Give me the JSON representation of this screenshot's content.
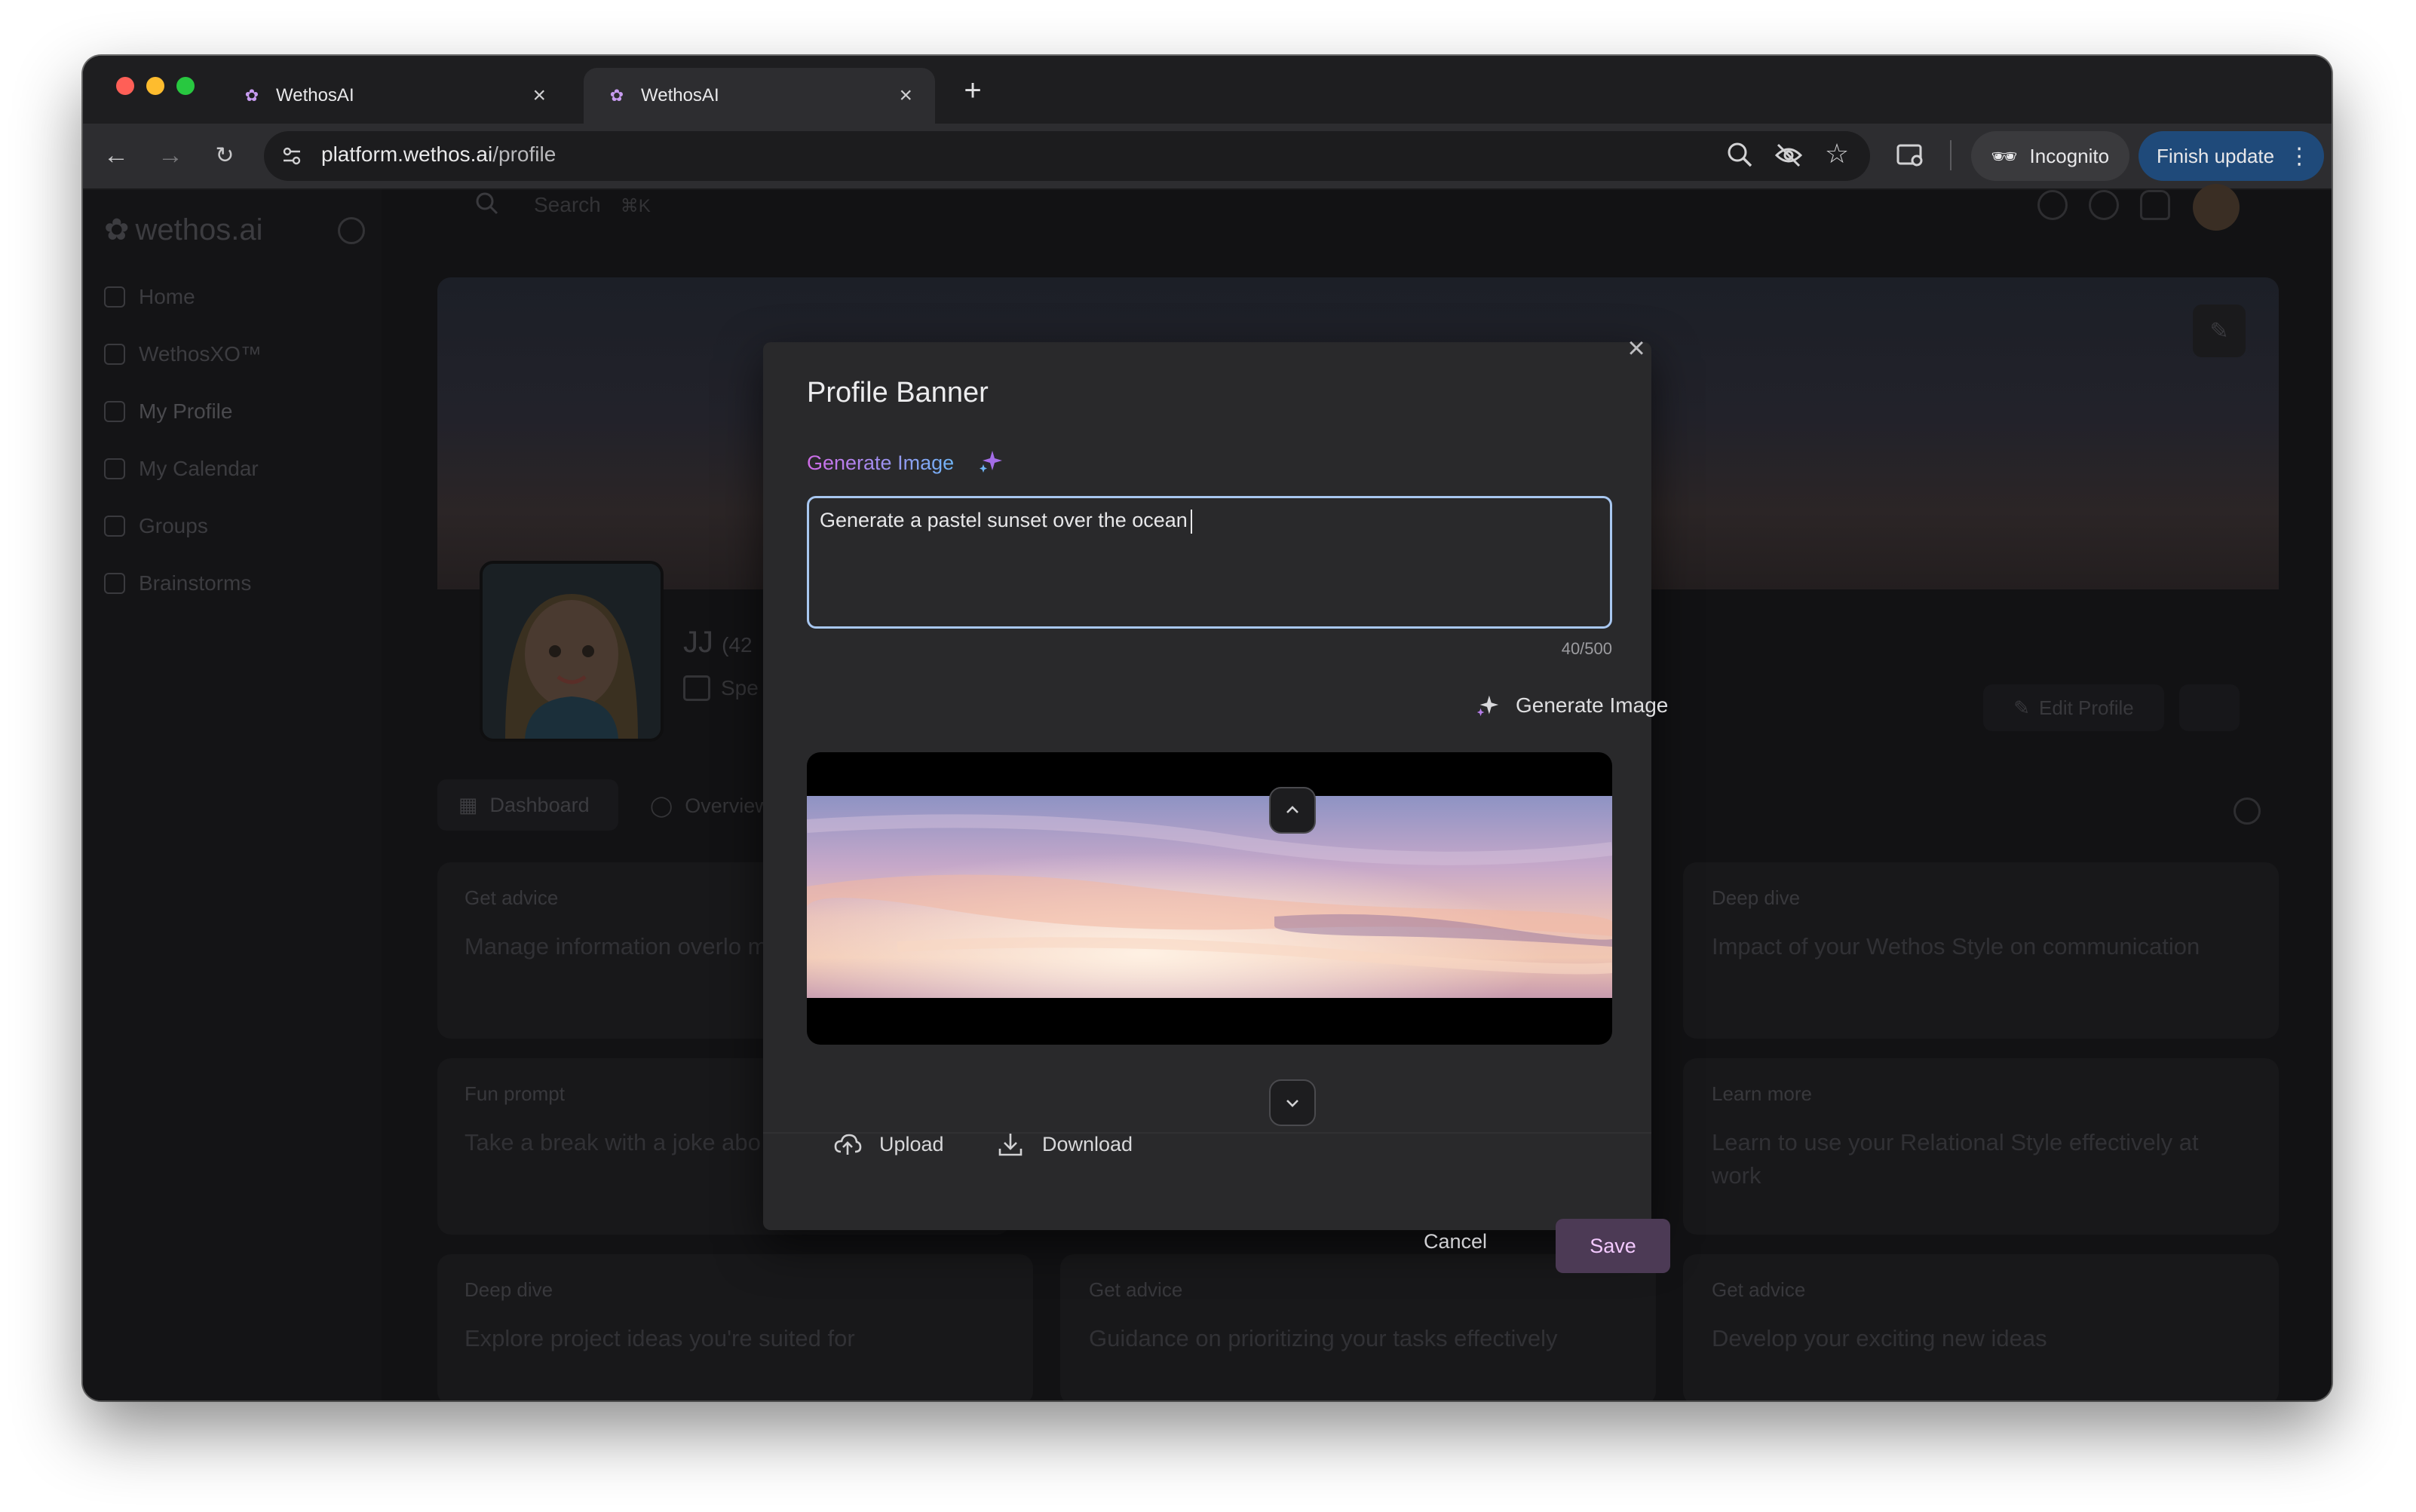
{
  "browser": {
    "tabs": [
      {
        "title": "WethosAI",
        "active": false
      },
      {
        "title": "WethosAI",
        "active": true
      }
    ],
    "new_tab_glyph": "+",
    "url_host": "platform.wethos.ai",
    "url_path": "/profile",
    "incognito_label": "Incognito",
    "update_label": "Finish update"
  },
  "app": {
    "logo_text": "wethos.ai",
    "search_placeholder": "Search",
    "search_shortcut": "⌘K",
    "sidebar": [
      {
        "label": "Home",
        "icon": "home-icon"
      },
      {
        "label": "WethosXO™",
        "icon": "xo-icon"
      },
      {
        "label": "My Profile",
        "icon": "user-icon"
      },
      {
        "label": "My Calendar",
        "icon": "calendar-icon"
      },
      {
        "label": "Groups",
        "icon": "groups-icon"
      },
      {
        "label": "Brainstorms",
        "icon": "bulb-icon"
      }
    ],
    "profile_name": "JJ",
    "profile_meta": "(42",
    "profile_sub": "Spe",
    "edit_profile": "Edit Profile",
    "tabs": [
      "Dashboard",
      "Overview"
    ],
    "cards": [
      {
        "tag": "Get advice",
        "text": "Manage information overlo messages"
      },
      {
        "tag": "Deep dive",
        "text": "Impact of your Wethos Style on communication"
      },
      {
        "tag": "Fun prompt",
        "text": "Take a break with a joke abo"
      },
      {
        "tag": "Learn more",
        "text": "Learn to use your Relational Style effectively at work"
      },
      {
        "tag": "Deep dive",
        "text": "Explore project ideas you're suited for"
      },
      {
        "tag": "Get advice",
        "text": "Guidance on prioritizing your tasks effectively"
      },
      {
        "tag": "Get advice",
        "text": "Develop your exciting new ideas"
      }
    ]
  },
  "modal": {
    "title": "Profile Banner",
    "generate_label": "Generate Image",
    "prompt_value": "Generate a pastel sunset over the ocean",
    "counter": "40/500",
    "generate_button": "Generate Image",
    "upload": "Upload",
    "download": "Download",
    "cancel": "Cancel",
    "save": "Save"
  },
  "colors": {
    "accent_gradient_start": "#d06be8",
    "accent_gradient_end": "#6fb4f5",
    "save_bg": "#4c3a55",
    "update_button": "#1f4a7a"
  }
}
